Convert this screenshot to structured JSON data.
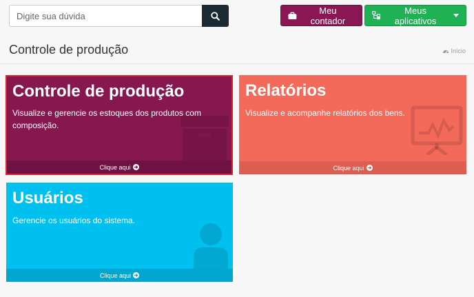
{
  "header": {
    "search_placeholder": "Digite sua dúvida",
    "counter_label": "Meu contador",
    "apps_label": "Meus aplicativos"
  },
  "page": {
    "title": "Controle de produção",
    "breadcrumb": "Início"
  },
  "cards": [
    {
      "title": "Controle de produção",
      "description": "Visualize e gerencie os estoques dos produtos com composição.",
      "link": "Clique aqui",
      "color": "#86174f",
      "icon": "box-icon"
    },
    {
      "title": "Relatórios",
      "description": "Visualize e acompanhe relatórios dos bens.",
      "link": "Clique aqui",
      "color": "#f3695a",
      "icon": "chart-presentation-icon"
    },
    {
      "title": "Usuários",
      "description": "Gerencie os usuários do sistema.",
      "link": "Clique aqui",
      "color": "#00c0ef",
      "icon": "user-icon"
    }
  ]
}
